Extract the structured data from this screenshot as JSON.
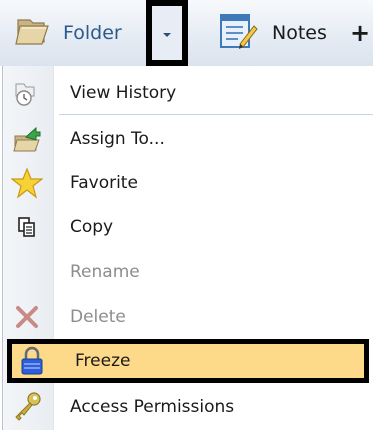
{
  "toolbar": {
    "folder_label": "Folder",
    "notes_label": "Notes",
    "plus_label": "+",
    "icons": {
      "folder": "folder-icon",
      "dropdown": "chevron-down-icon",
      "notes": "notes-icon"
    }
  },
  "menu": {
    "items": [
      {
        "label": "View History",
        "icon": "history-icon",
        "enabled": true
      },
      {
        "label": "Assign To...",
        "icon": "assign-icon",
        "enabled": true
      },
      {
        "label": "Favorite",
        "icon": "star-icon",
        "enabled": true
      },
      {
        "label": "Copy",
        "icon": "copy-icon",
        "enabled": true
      },
      {
        "label": "Rename",
        "icon": "",
        "enabled": false
      },
      {
        "label": "Delete",
        "icon": "delete-icon",
        "enabled": false
      },
      {
        "label": "Freeze",
        "icon": "lock-icon",
        "enabled": true,
        "highlighted": true
      },
      {
        "label": "Access Permissions",
        "icon": "key-icon",
        "enabled": true
      }
    ]
  },
  "colors": {
    "highlight": "#fdd98a",
    "folder_text": "#2d5a8c",
    "disabled_text": "#8d8d8d"
  }
}
